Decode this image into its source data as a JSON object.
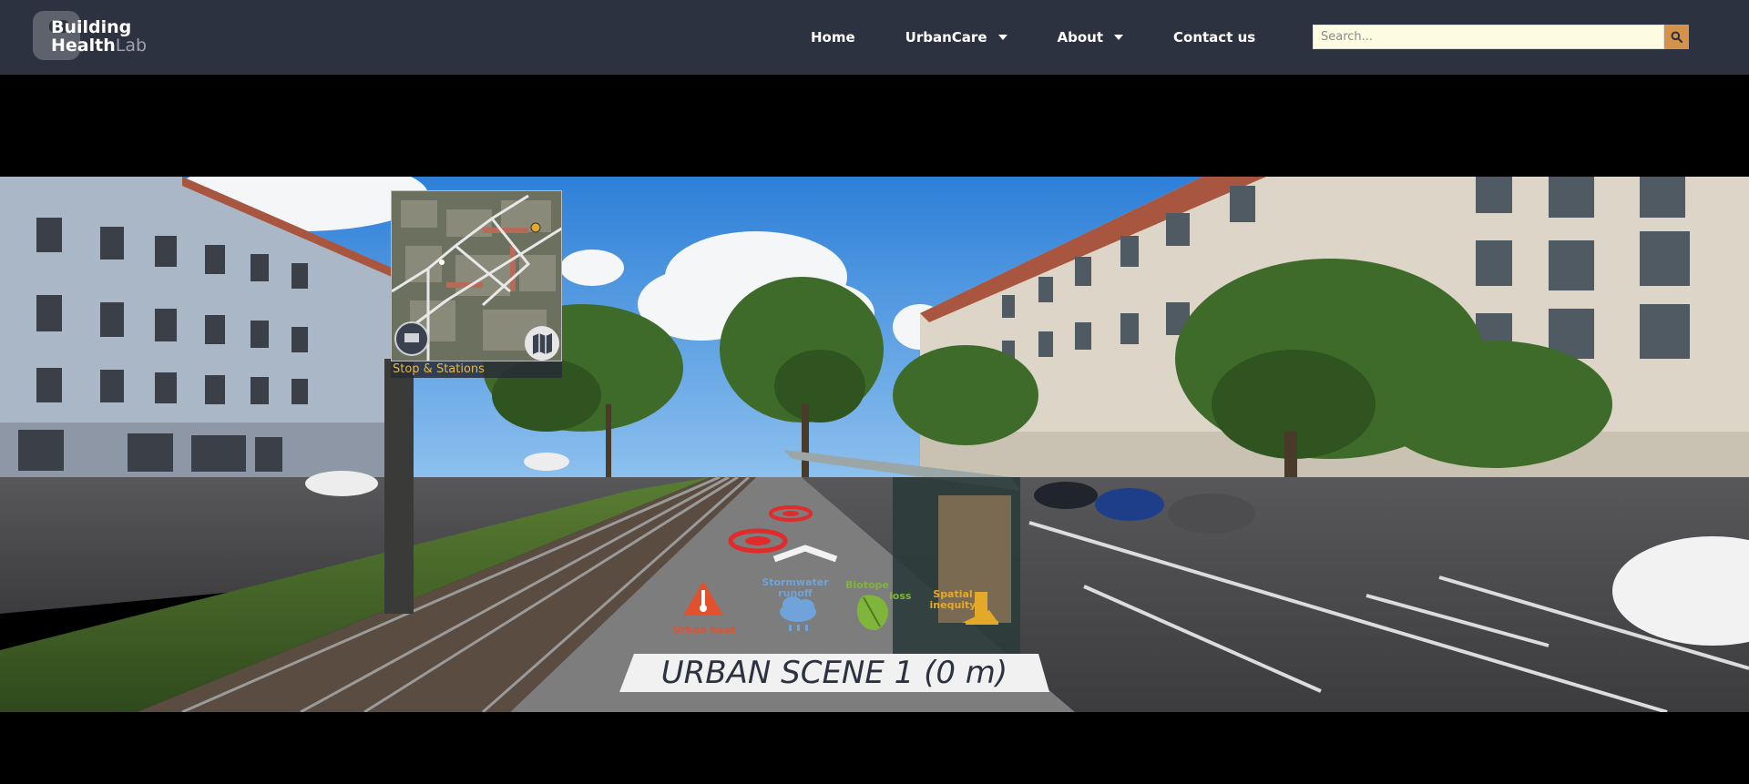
{
  "header": {
    "logo": {
      "line1": "Building",
      "line2": "Health",
      "line3": "Lab"
    },
    "nav": [
      {
        "label": "Home"
      },
      {
        "label": "UrbanCare"
      },
      {
        "label": "About"
      },
      {
        "label": "Contact us"
      }
    ],
    "search": {
      "placeholder": "Search..."
    }
  },
  "viewer": {
    "minimap_label": "Stop & Stations",
    "hotspots": {
      "urban_heat": "Urban heat",
      "stormwater_line1": "Stormwater",
      "stormwater_line2": "runoff",
      "biotope_line1": "Biotope",
      "biotope_line2": "loss",
      "spatial_line1": "Spatial",
      "spatial_line2": "inequity"
    },
    "scene_title": "URBAN SCENE 1 (0 m)"
  },
  "colors": {
    "header_bg": "#2c3240",
    "search_bg": "#fefbe3",
    "search_button": "#d4924a",
    "urban_heat": "#e2502e",
    "stormwater": "#6fa3d9",
    "biotope": "#7fb53a",
    "spatial": "#e5a92a"
  }
}
